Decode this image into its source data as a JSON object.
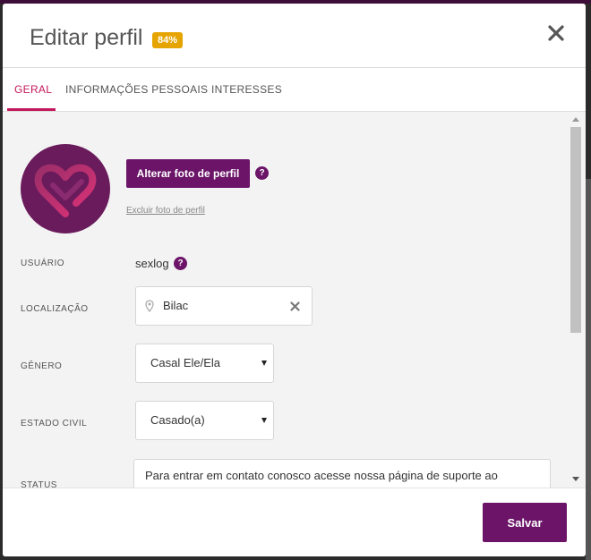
{
  "modal": {
    "title": "Editar perfil",
    "completion_badge": "84%"
  },
  "tabs": [
    {
      "label": "GERAL",
      "active": true
    },
    {
      "label": "INFORMAÇÕES PESSOAIS",
      "active": false
    },
    {
      "label": "INTERESSES",
      "active": false
    }
  ],
  "photo": {
    "change_label": "Alterar foto de perfil",
    "delete_label": "Excluir foto de perfil",
    "help_glyph": "?"
  },
  "fields": {
    "username": {
      "label": "USUÁRIO",
      "value": "sexlog",
      "help_glyph": "?"
    },
    "location": {
      "label": "LOCALIZAÇÃO",
      "value": "Bilac",
      "icon": "map-pin-icon"
    },
    "gender": {
      "label": "GÊNERO",
      "selected": "Casal Ele/Ela"
    },
    "marital_status": {
      "label": "ESTADO CIVIL",
      "selected": "Casado(a)"
    },
    "status": {
      "label": "STATUS",
      "value": "Para entrar em contato conosco acesse nossa página de suporte ao"
    }
  },
  "footer": {
    "save_label": "Salvar"
  },
  "colors": {
    "brand": "#6b1468",
    "accent": "#c2185b",
    "badge": "#e6a400"
  }
}
